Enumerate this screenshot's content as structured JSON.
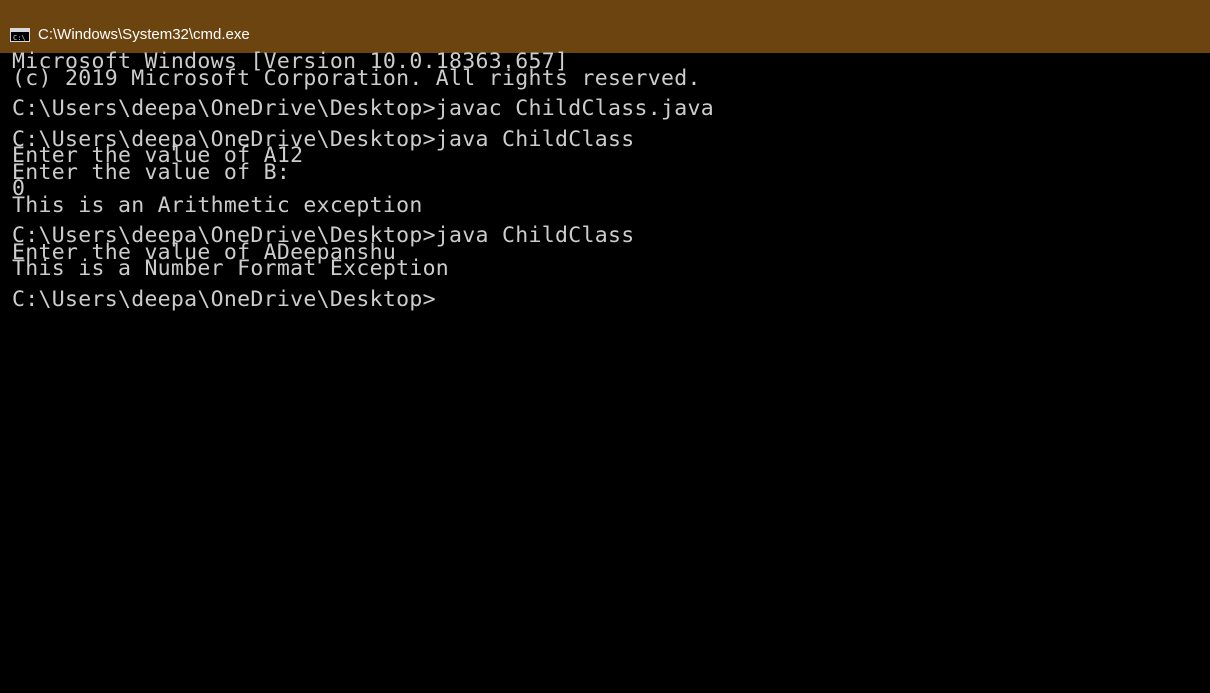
{
  "window": {
    "title": "C:\\Windows\\System32\\cmd.exe",
    "icon": "cmd-icon"
  },
  "console": {
    "lines": [
      "Microsoft Windows [Version 10.0.18363.657]",
      "(c) 2019 Microsoft Corporation. All rights reserved.",
      "",
      "C:\\Users\\deepa\\OneDrive\\Desktop>javac ChildClass.java",
      "",
      "C:\\Users\\deepa\\OneDrive\\Desktop>java ChildClass",
      "Enter the value of A12",
      "Enter the value of B:",
      "0",
      "This is an Arithmetic exception",
      "",
      "C:\\Users\\deepa\\OneDrive\\Desktop>java ChildClass",
      "Enter the value of ADeepanshu",
      "This is a Number Format Exception",
      "",
      "C:\\Users\\deepa\\OneDrive\\Desktop>"
    ]
  }
}
